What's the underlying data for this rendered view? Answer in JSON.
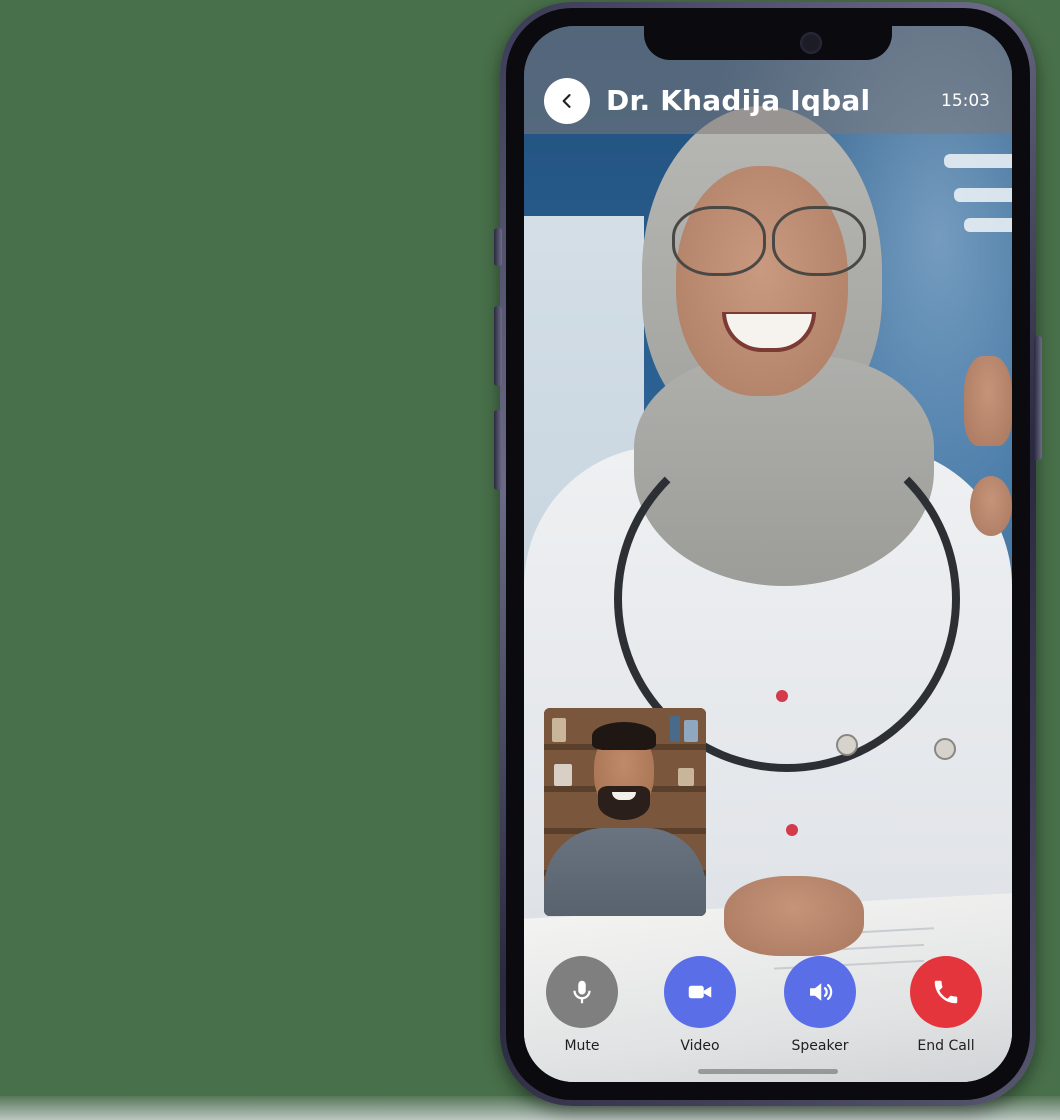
{
  "call": {
    "caller_name": "Dr. Khadija Iqbal",
    "timer": "15:03"
  },
  "controls": [
    {
      "id": "mute",
      "label": "Mute",
      "icon": "microphone-icon",
      "color": "#7f7f7f"
    },
    {
      "id": "video",
      "label": "Video",
      "icon": "video-camera-icon",
      "color": "#5a6ee8"
    },
    {
      "id": "speaker",
      "label": "Speaker",
      "icon": "speaker-icon",
      "color": "#5a6ee8"
    },
    {
      "id": "end_call",
      "label": "End Call",
      "icon": "phone-hangup-icon",
      "color": "#e3353b"
    }
  ],
  "icons": {
    "back": "chevron-left-icon"
  },
  "colors": {
    "background": "#48704a",
    "phone_frame": "#3b3a55",
    "header_overlay": "#7d7878",
    "accent": "#5a6ee8",
    "danger": "#e3353b",
    "muted": "#7f7f7f"
  }
}
